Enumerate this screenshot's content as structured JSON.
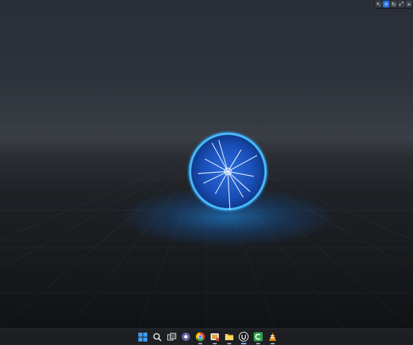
{
  "viewport": {
    "scene": "3d-editor-viewport",
    "accent_color": "#1e96ff"
  },
  "toolbar": {
    "tools": [
      {
        "name": "select-tool",
        "icon": "cursor-arrow-icon",
        "active": false
      },
      {
        "name": "move-tool",
        "icon": "move-cross-icon",
        "active": true
      },
      {
        "name": "rotate-tool",
        "icon": "rotate-icon",
        "active": false
      },
      {
        "name": "scale-tool",
        "icon": "scale-icon",
        "active": false
      },
      {
        "name": "more-tool",
        "icon": "more-icon",
        "active": false
      }
    ]
  },
  "taskbar": {
    "apps": [
      {
        "name": "windows-start",
        "icon": "windows-logo-icon",
        "color": "#3a9bf0"
      },
      {
        "name": "search",
        "icon": "search-icon",
        "color": "#e8e8e8"
      },
      {
        "name": "task-view",
        "icon": "task-view-icon",
        "color": "#d0d0d0"
      },
      {
        "name": "chat",
        "icon": "chat-bubble-icon",
        "color": "#6264a7"
      },
      {
        "name": "chrome",
        "icon": "chrome-icon",
        "color": "#e94235"
      },
      {
        "name": "snipping-tool",
        "icon": "snip-icon",
        "color": "#e2a33a"
      },
      {
        "name": "file-explorer",
        "icon": "folder-icon",
        "color": "#f6c343"
      },
      {
        "name": "unreal-engine",
        "icon": "unreal-logo-icon",
        "color": "#ffffff"
      },
      {
        "name": "camtasia",
        "icon": "camtasia-icon",
        "color": "#2ea84b"
      },
      {
        "name": "vlc",
        "icon": "vlc-cone-icon",
        "color": "#f08a00"
      }
    ]
  }
}
